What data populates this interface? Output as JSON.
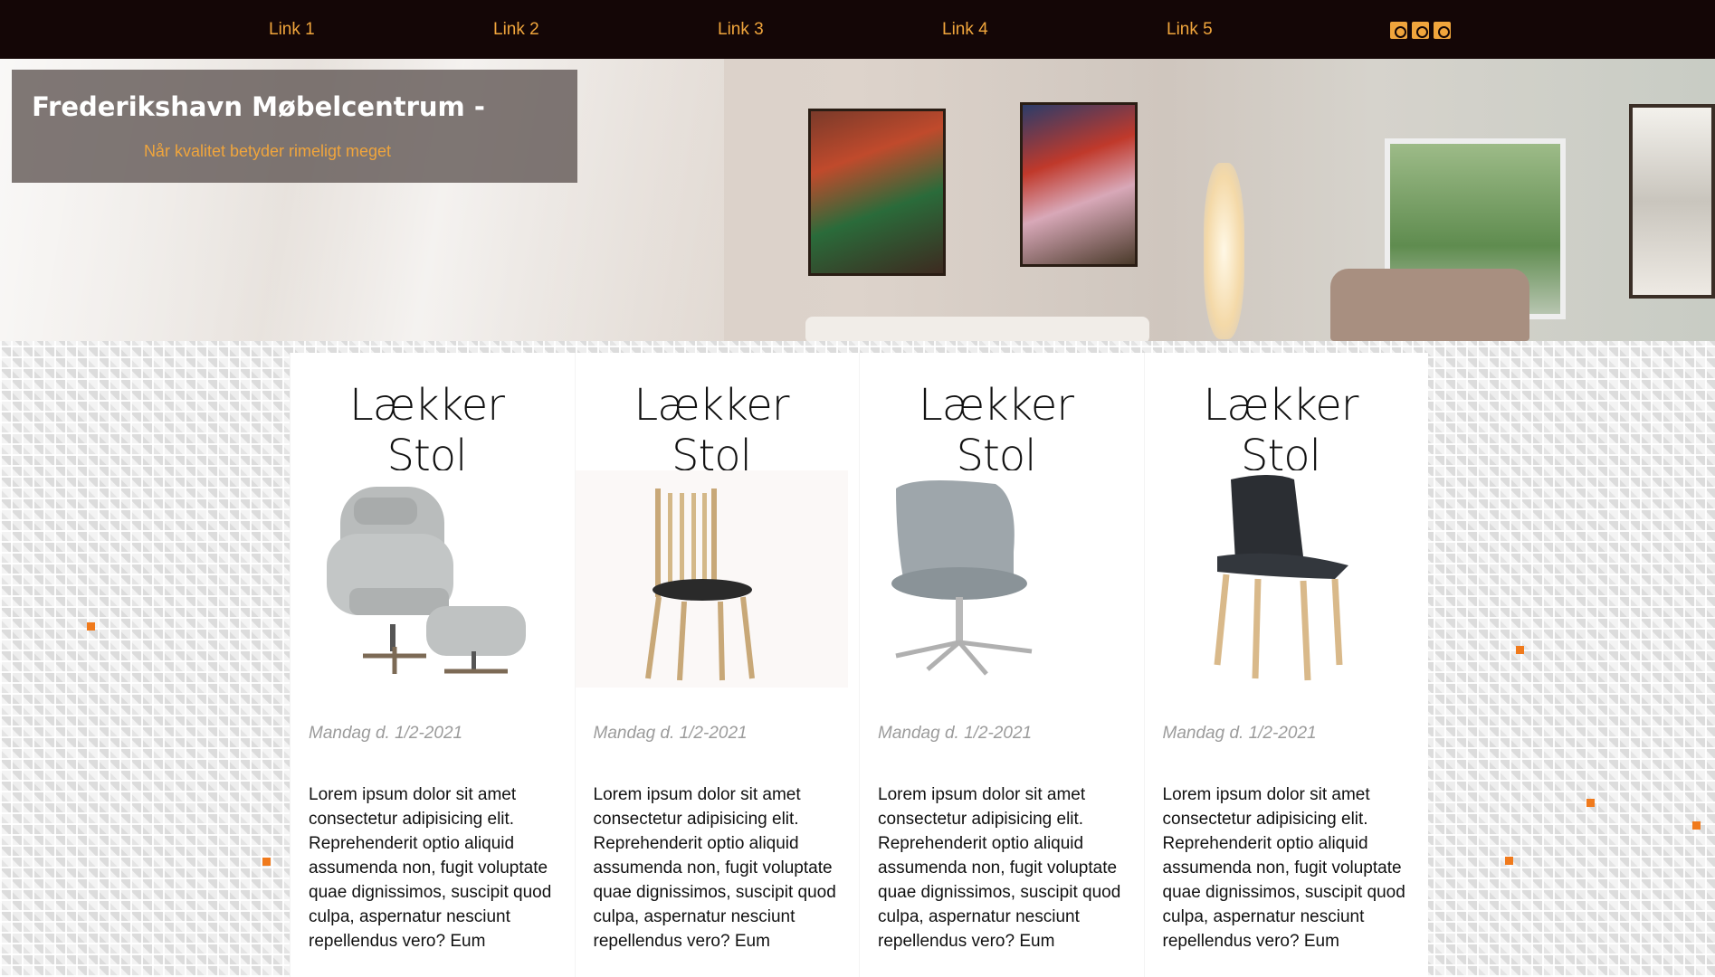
{
  "nav": {
    "links": [
      "Link 1",
      "Link 2",
      "Link 3",
      "Link 4",
      "Link 5"
    ],
    "social_icons": [
      "twitter-icon",
      "facebook-icon",
      "instagram-icon"
    ]
  },
  "header": {
    "title": "Frederikshavn Møbelcentrum -",
    "subtitle": "Når kvalitet betyder rimeligt meget"
  },
  "cards": [
    {
      "title": "Lækker Stol",
      "image": "gray-wingback-chair-with-footstool",
      "date": "Mandag d. 1/2-2021",
      "text": "Lorem ipsum dolor sit amet consectetur adipisicing elit. Reprehenderit optio aliquid assumenda non, fugit voluptate quae dignissimos, suscipit quod culpa, aspernatur nesciunt repellendus vero? Eum"
    },
    {
      "title": "Lækker Stol",
      "image": "wooden-slat-back-dining-chair",
      "date": "Mandag d. 1/2-2021",
      "text": "Lorem ipsum dolor sit amet consectetur adipisicing elit. Reprehenderit optio aliquid assumenda non, fugit voluptate quae dignissimos, suscipit quod culpa, aspernatur nesciunt repellendus vero? Eum"
    },
    {
      "title": "Lækker Stol",
      "image": "gray-swivel-chair-steel-base",
      "date": "Mandag d. 1/2-2021",
      "text": "Lorem ipsum dolor sit amet consectetur adipisicing elit. Reprehenderit optio aliquid assumenda non, fugit voluptate quae dignissimos, suscipit quod culpa, aspernatur nesciunt repellendus vero? Eum"
    },
    {
      "title": "Lækker Stol",
      "image": "black-leather-chair-oak-legs",
      "date": "Mandag d. 1/2-2021",
      "text": "Lorem ipsum dolor sit amet consectetur adipisicing elit. Reprehenderit optio aliquid assumenda non, fugit voluptate quae dignissimos, suscipit quod culpa, aspernatur nesciunt repellendus vero? Eum"
    }
  ],
  "colors": {
    "nav_bg": "#140606",
    "accent": "#f0a53c",
    "title_box": "#645a58",
    "dot": "#f07a1c"
  }
}
